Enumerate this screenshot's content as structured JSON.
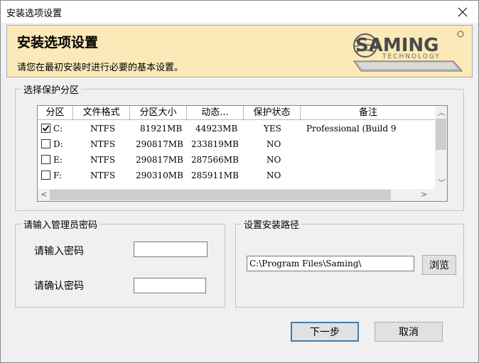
{
  "window": {
    "title": "安装选项设置"
  },
  "banner": {
    "title": "安装选项设置",
    "subtitle": "请您在最初安装时进行必要的基本设置。",
    "logo_text": "SAMING",
    "logo_sub": "TECHNOLOGY"
  },
  "partition_group": {
    "label": "选择保护分区",
    "columns": [
      "分区",
      "文件格式",
      "分区大小",
      "动态...",
      "保护状态",
      "备注"
    ],
    "rows": [
      {
        "checked": true,
        "drive": "C:",
        "format": "NTFS",
        "size": "81921MB",
        "dynamic": "44923MB",
        "status": "YES",
        "note": "Professional  (Build 9"
      },
      {
        "checked": false,
        "drive": "D:",
        "format": "NTFS",
        "size": "290817MB",
        "dynamic": "233819MB",
        "status": "NO",
        "note": ""
      },
      {
        "checked": false,
        "drive": "E:",
        "format": "NTFS",
        "size": "290817MB",
        "dynamic": "287566MB",
        "status": "NO",
        "note": ""
      },
      {
        "checked": false,
        "drive": "F:",
        "format": "NTFS",
        "size": "290310MB",
        "dynamic": "285911MB",
        "status": "NO",
        "note": ""
      }
    ]
  },
  "password_group": {
    "label": "请输入管理员密码",
    "password_label": "请输入密码",
    "confirm_label": "请确认密码",
    "password_value": "",
    "confirm_value": ""
  },
  "path_group": {
    "label": "设置安装路径",
    "path_value": "C:\\Program Files\\Saming\\",
    "browse_label": "浏览"
  },
  "buttons": {
    "next_label": "下一步",
    "cancel_label": "取消"
  },
  "colors": {
    "banner_bg": "#fbe9b8",
    "dialog_bg": "#f0f0f0",
    "default_border": "#3c7fb1"
  }
}
